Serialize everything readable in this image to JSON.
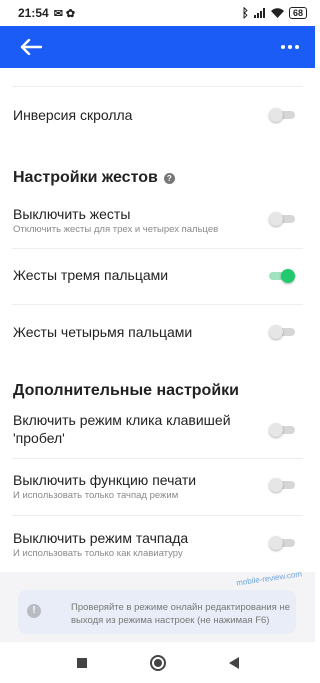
{
  "status": {
    "time": "21:54",
    "battery": "68"
  },
  "settings": {
    "scroll_inversion": {
      "title": "Инверсия скролла",
      "on": false
    },
    "gestures_section": "Настройки жестов",
    "disable_gestures": {
      "title": "Выключить жесты",
      "subtitle": "Отключить жесты для трех и четырех пальцев",
      "on": false
    },
    "three_finger": {
      "title": "Жесты тремя пальцами",
      "on": true
    },
    "four_finger": {
      "title": "Жесты четырьмя пальцами",
      "on": false
    },
    "additional_section": "Дополнительные настройки",
    "space_click": {
      "title_line1": "Включить режим клика клавишей",
      "title_line2": "'пробел'",
      "on": false
    },
    "disable_print": {
      "title": "Выключить функцию печати",
      "subtitle": "И использовать только тачпад режим",
      "on": false
    },
    "disable_touchpad": {
      "title": "Выключить режим тачпада",
      "subtitle": "И использовать только как клавиатуру",
      "on": false
    }
  },
  "note": {
    "text": "Проверяйте в режиме онлайн редактирования не выходя из режима настроек (не нажимая F6)"
  },
  "watermark": "mobile-review.com",
  "colors": {
    "accent": "#1a5cf5",
    "toggle_on": "#22c96f"
  }
}
